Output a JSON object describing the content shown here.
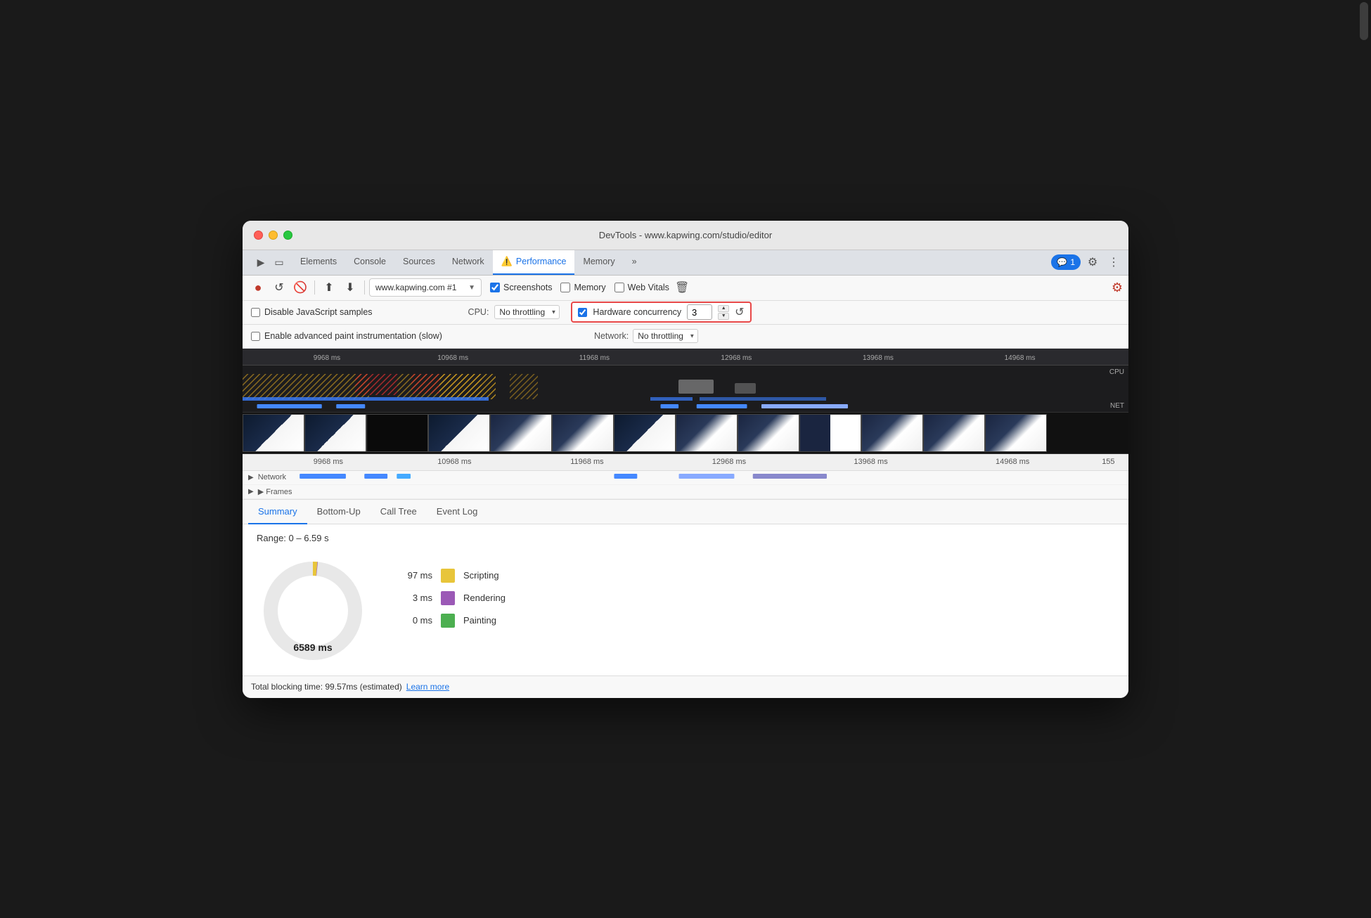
{
  "window": {
    "title": "DevTools - www.kapwing.com/studio/editor"
  },
  "devtools_tabs": {
    "items": [
      {
        "id": "elements",
        "label": "Elements",
        "active": false
      },
      {
        "id": "console",
        "label": "Console",
        "active": false
      },
      {
        "id": "sources",
        "label": "Sources",
        "active": false
      },
      {
        "id": "network",
        "label": "Network",
        "active": false
      },
      {
        "id": "performance",
        "label": "Performance",
        "active": true,
        "icon": "⚠️"
      },
      {
        "id": "memory",
        "label": "Memory",
        "active": false
      }
    ],
    "more": "»",
    "notifications_count": "1"
  },
  "toolbar1": {
    "record_label": "●",
    "reload_label": "↺",
    "stop_label": "🚫",
    "upload_label": "⬆",
    "download_label": "⬇",
    "url_text": "www.kapwing.com #1",
    "screenshots_label": "Screenshots",
    "memory_label": "Memory",
    "web_vitals_label": "Web Vitals",
    "trash_label": "🗑"
  },
  "toolbar2": {
    "disable_js_label": "Disable JavaScript samples",
    "cpu_label": "CPU:",
    "cpu_throttle_label": "No throttling",
    "hw_concurrency_label": "Hardware concurrency",
    "hw_value": "3",
    "undo_label": "↺"
  },
  "toolbar3": {
    "advanced_paint_label": "Enable advanced paint instrumentation (slow)",
    "network_label": "Network:",
    "network_throttle_label": "No throttling"
  },
  "timeline": {
    "ruler_marks": [
      {
        "label": "9968 ms",
        "position": 8
      },
      {
        "label": "10968 ms",
        "position": 22
      },
      {
        "label": "11968 ms",
        "position": 38
      },
      {
        "label": "12968 ms",
        "position": 54
      },
      {
        "label": "13968 ms",
        "position": 71
      },
      {
        "label": "14968 ms",
        "position": 87
      }
    ],
    "ruler2_marks": [
      {
        "label": "9968 ms",
        "position": 8
      },
      {
        "label": "10968 ms",
        "position": 22
      },
      {
        "label": "11968 ms",
        "position": 38
      },
      {
        "label": "12968 ms",
        "position": 54
      },
      {
        "label": "13968 ms",
        "position": 71
      },
      {
        "label": "14968 ms",
        "position": 87
      },
      {
        "label": "155",
        "position": 98
      }
    ],
    "cpu_label": "CPU",
    "net_label": "NET",
    "network_track_label": "▶ Network",
    "frames_track_label": "▶ Frames"
  },
  "bottom_tabs": {
    "items": [
      {
        "id": "summary",
        "label": "Summary",
        "active": true
      },
      {
        "id": "bottom-up",
        "label": "Bottom-Up",
        "active": false
      },
      {
        "id": "call-tree",
        "label": "Call Tree",
        "active": false
      },
      {
        "id": "event-log",
        "label": "Event Log",
        "active": false
      }
    ]
  },
  "summary": {
    "range_label": "Range: 0 – 6.59 s",
    "center_value": "6589 ms",
    "legend": [
      {
        "value": "97 ms",
        "color": "#e8c53a",
        "label": "Scripting"
      },
      {
        "value": "3 ms",
        "color": "#9b59b6",
        "label": "Rendering"
      },
      {
        "value": "0 ms",
        "color": "#4caf50",
        "label": "Painting"
      }
    ]
  },
  "status_bar": {
    "text": "Total blocking time: 99.57ms (estimated)",
    "link_text": "Learn more"
  },
  "colors": {
    "accent_blue": "#1a73e8",
    "tab_active_underline": "#1a73e8",
    "hw_border_red": "#e84848"
  }
}
